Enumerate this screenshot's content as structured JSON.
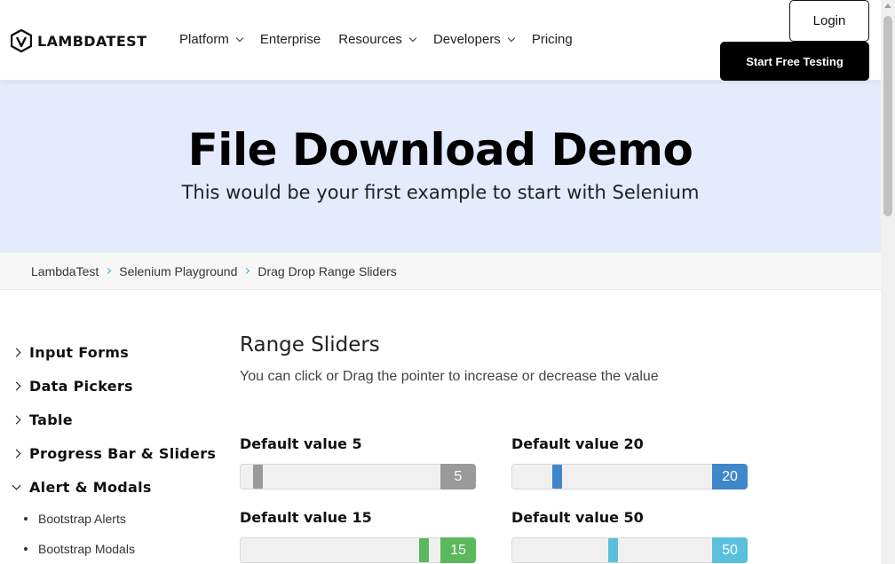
{
  "header": {
    "logo_text": "LAMBDATEST",
    "nav": [
      {
        "label": "Platform",
        "has_dropdown": true
      },
      {
        "label": "Enterprise",
        "has_dropdown": false
      },
      {
        "label": "Resources",
        "has_dropdown": true
      },
      {
        "label": "Developers",
        "has_dropdown": true
      },
      {
        "label": "Pricing",
        "has_dropdown": false
      }
    ],
    "login_label": "Login",
    "start_label": "Start Free Testing"
  },
  "hero": {
    "title": "File Download Demo",
    "subtitle": "This would be your first example to start with Selenium"
  },
  "breadcrumb": [
    "LambdaTest",
    "Selenium Playground",
    "Drag Drop Range Sliders"
  ],
  "sidebar": {
    "items": [
      {
        "label": "Input Forms",
        "expanded": false
      },
      {
        "label": "Data Pickers",
        "expanded": false
      },
      {
        "label": "Table",
        "expanded": false
      },
      {
        "label": "Progress Bar & Sliders",
        "expanded": false
      },
      {
        "label": "Alert & Modals",
        "expanded": true
      }
    ],
    "subitems": [
      "Bootstrap Alerts",
      "Bootstrap Modals"
    ]
  },
  "main": {
    "title": "Range Sliders",
    "description": "You can click or Drag the pointer to increase or decrease the value"
  },
  "sliders": [
    {
      "label": "Default value 5",
      "value": "5",
      "fraction": 0.05,
      "color": "#9a9a9a"
    },
    {
      "label": "Default value 20",
      "value": "20",
      "fraction": 0.2,
      "color": "#3f87c9"
    },
    {
      "label": "Default value 15",
      "value": "15",
      "fraction": 0.95,
      "color": "#5cb85c"
    },
    {
      "label": "Default value 50",
      "value": "50",
      "fraction": 0.5,
      "color": "#5bc0de"
    }
  ]
}
